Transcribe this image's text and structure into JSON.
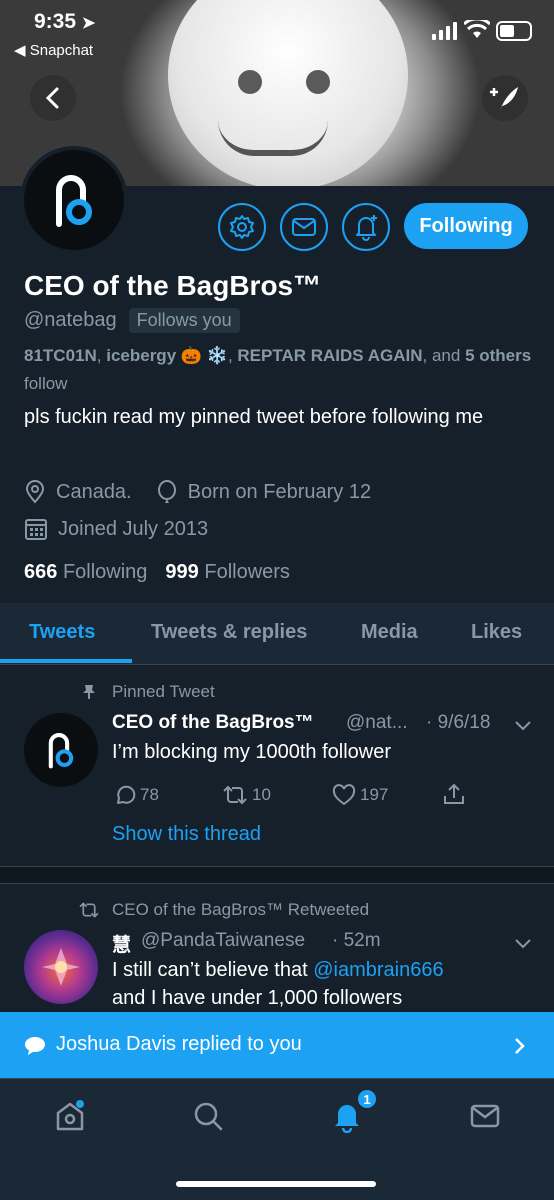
{
  "status_bar": {
    "time": "9:35",
    "back_app": "Snapchat"
  },
  "profile": {
    "name": "CEO of the BagBros™",
    "handle": "@natebag",
    "follows_you": "Follows you",
    "followed_by": {
      "names": [
        "81TC01N",
        "icebergy 🎃 ❄️",
        "REPTAR RAIDS AGAIN"
      ],
      "separator": ", ",
      "and": ", and",
      "others": "5 others",
      "suffix": "follow"
    },
    "bio": "pls fuckin read my pinned tweet before following me",
    "location": "Canada.",
    "birthday": "Born on February 12",
    "joined": "Joined July 2013",
    "following_count": "666",
    "following_label": "Following",
    "followers_count": "999",
    "followers_label": "Followers",
    "follow_button": "Following"
  },
  "tabs": [
    "Tweets",
    "Tweets & replies",
    "Media",
    "Likes"
  ],
  "pinned_tweet": {
    "context": "Pinned Tweet",
    "author": "CEO of the BagBros™",
    "handle": "@nat...",
    "date": "· 9/6/18",
    "text": "I’m blocking my 1000th follower",
    "replies": "78",
    "retweets": "10",
    "likes": "197",
    "thread_link": "Show this thread"
  },
  "retweet": {
    "context": "CEO of the BagBros™ Retweeted",
    "author": "慧",
    "handle": "@PandaTaiwanese",
    "time": "· 52m",
    "text_before": "I still can’t believe that ",
    "mention": "@iambrain666",
    "text_after": "and I have under 1,000 followers"
  },
  "notification": {
    "text": "Joshua Davis replied to you"
  },
  "bottom_nav": {
    "notifications_badge": "1"
  },
  "colors": {
    "background": "#15202b",
    "accent": "#1da1f2",
    "secondary_text": "#8899a6"
  }
}
